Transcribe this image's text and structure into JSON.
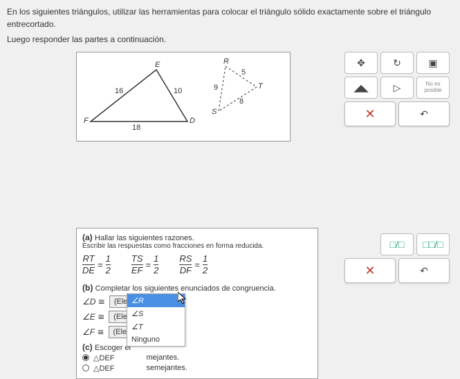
{
  "instructions": {
    "line1": "En los siguientes triángulos, utilizar las herramientas para colocar el triángulo sólido exactamente sobre el triángulo entrecortado.",
    "line2": "Luego responder las partes a continuación."
  },
  "figure": {
    "tri_main": {
      "E": "E",
      "F": "F",
      "D": "D",
      "s16": "16",
      "s10": "10",
      "s18": "18"
    },
    "tri_dash": {
      "R": "R",
      "S": "S",
      "T": "T",
      "s5": "5",
      "s8": "8",
      "s9": "9"
    }
  },
  "tools": {
    "move": "✥",
    "rotate": "↻",
    "box": "▣",
    "flip_h": "◢◣",
    "flip_v": "▷",
    "not_possible": "No es posible",
    "close": "✕",
    "reset": "↶",
    "frac_tool": "□/□",
    "mixed_tool": "□□/□"
  },
  "parts": {
    "a": {
      "label": "(a)",
      "title": "Hallar las siguientes razones.",
      "sub": "Escribir las respuestas como fracciones en forma reducida.",
      "r1_top": "RT",
      "r1_bot": "DE",
      "v1_top": "1",
      "v1_bot": "2",
      "r2_top": "TS",
      "r2_bot": "EF",
      "v2_top": "1",
      "v2_bot": "2",
      "r3_top": "RS",
      "r3_bot": "DF",
      "v3_top": "1",
      "v3_bot": "2"
    },
    "b": {
      "label": "(b)",
      "title": "Completar los siguientes enunciados de congruencia.",
      "angD": "∠D",
      "angE": "∠E",
      "angF": "∠F",
      "cong": "≅",
      "placeholder": "(Elegir uno)",
      "options": {
        "R": "∠R",
        "S": "∠S",
        "T": "∠T",
        "none": "Ninguno"
      }
    },
    "c": {
      "label": "(c)",
      "title": "Escoger el",
      "opt1_pre": "△DEF",
      "opt1_suf": "mejantes.",
      "opt2_pre": "△DEF",
      "opt2_suf": "semejantes."
    }
  }
}
